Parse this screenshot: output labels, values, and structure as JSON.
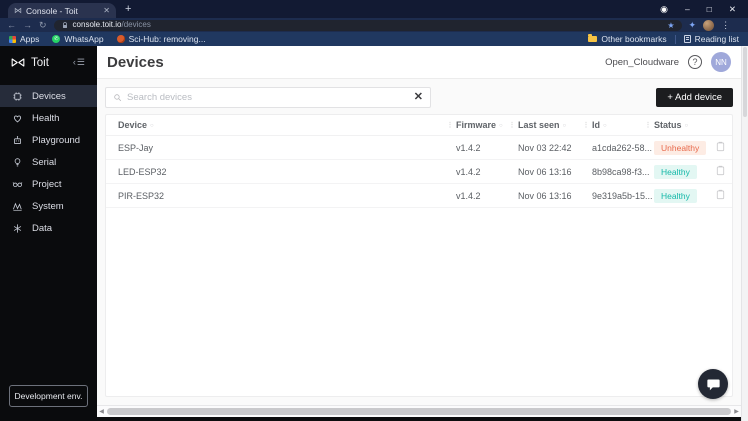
{
  "browser": {
    "tab": {
      "title": "Console - Toit"
    },
    "url": {
      "host": "console.toit.io",
      "path": "/devices"
    },
    "bookmarks_left": [
      {
        "label": "Apps"
      },
      {
        "label": "WhatsApp"
      },
      {
        "label": "Sci-Hub: removing..."
      }
    ],
    "bookmarks_right": [
      {
        "label": "Other bookmarks"
      },
      {
        "label": "Reading list"
      }
    ]
  },
  "sidebar": {
    "brand": "Toit",
    "items": [
      {
        "label": "Devices"
      },
      {
        "label": "Health"
      },
      {
        "label": "Playground"
      },
      {
        "label": "Serial"
      },
      {
        "label": "Project"
      },
      {
        "label": "System"
      },
      {
        "label": "Data"
      }
    ],
    "footer_button": "Development env."
  },
  "header": {
    "title": "Devices",
    "org": "Open_Cloudware",
    "help": "?",
    "avatar_initials": "NN"
  },
  "toolbar": {
    "search_placeholder": "Search devices",
    "add_device_label": "+ Add device"
  },
  "table": {
    "columns": [
      "Device",
      "Firmware",
      "Last seen",
      "Id",
      "Status"
    ],
    "rows": [
      {
        "device": "ESP-Jay",
        "firmware": "v1.4.2",
        "last_seen": "Nov 03 22:42",
        "id": "a1cda262-58...",
        "status": "Unhealthy"
      },
      {
        "device": "LED-ESP32",
        "firmware": "v1.4.2",
        "last_seen": "Nov 06 13:16",
        "id": "8b98ca98-f3...",
        "status": "Healthy"
      },
      {
        "device": "PIR-ESP32",
        "firmware": "v1.4.2",
        "last_seen": "Nov 06 13:16",
        "id": "9e319a5b-15...",
        "status": "Healthy"
      }
    ]
  },
  "colors": {
    "healthy": "#14b8a8",
    "healthy-bg": "#e3f7f3",
    "unhealthy": "#e8694b",
    "unhealthy-bg": "#fdece4",
    "add-button": "#1c1d1f",
    "sidebar-bg": "#0a0b0d",
    "sidebar-active": "#262c3a",
    "chrome-titlebar": "#121a33",
    "chrome-toolbar": "#1d2c4e",
    "chrome-bookmarks": "#203860",
    "avatar-bg": "#9fa8da"
  }
}
